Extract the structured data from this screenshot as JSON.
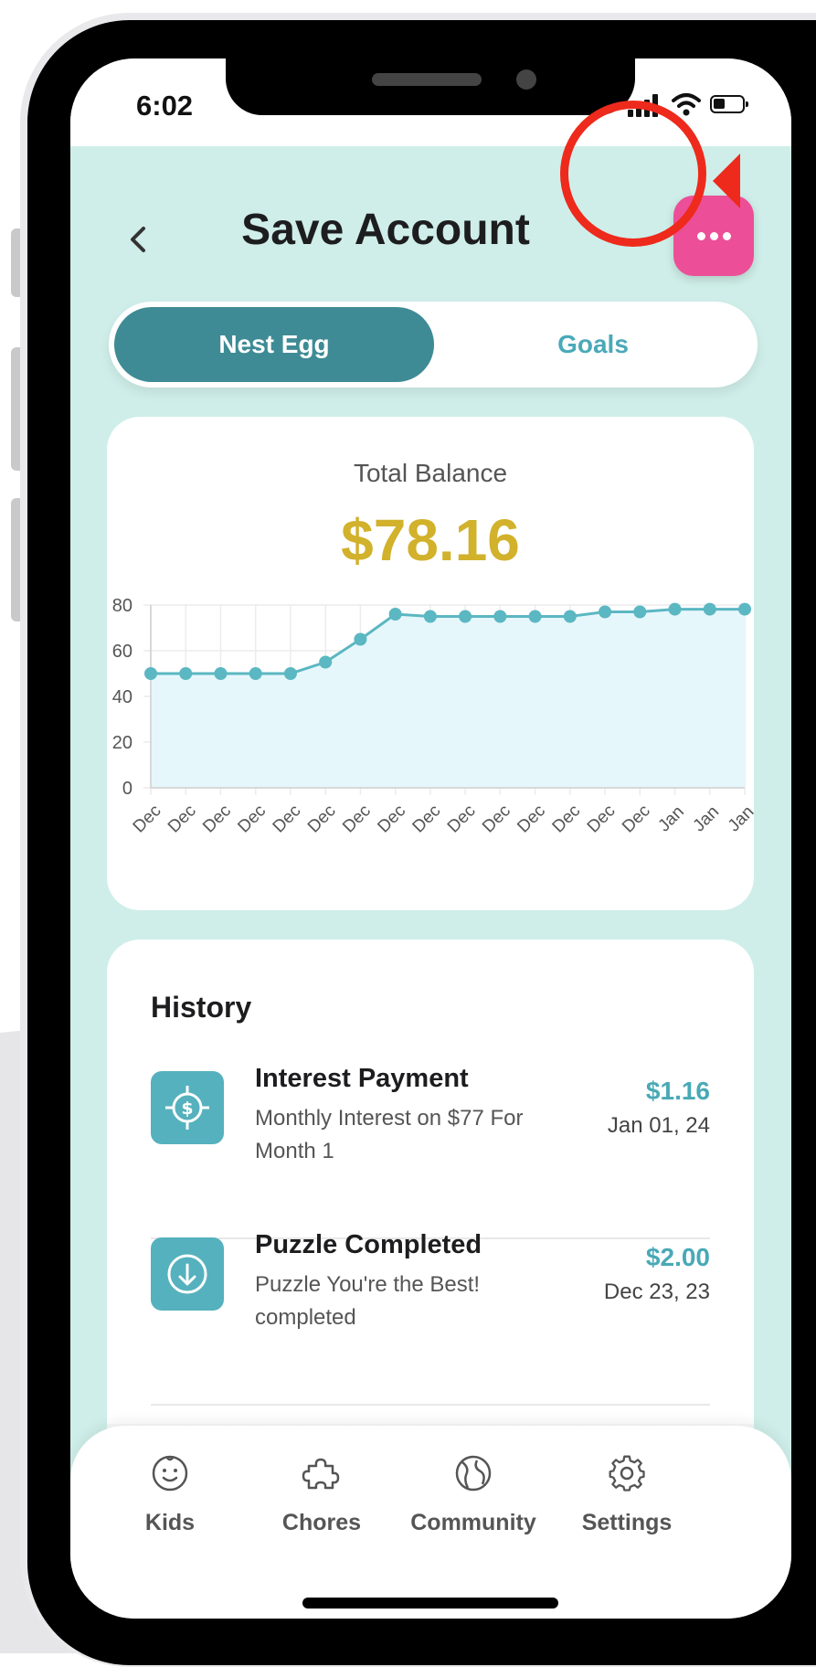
{
  "status_bar": {
    "time": "6:02"
  },
  "header": {
    "title": "Save Account"
  },
  "segmented": {
    "active": "Nest Egg",
    "inactive": "Goals"
  },
  "balance": {
    "label": "Total Balance",
    "amount": "$78.16"
  },
  "chart_data": {
    "type": "area",
    "categories": [
      "Dec",
      "Dec",
      "Dec",
      "Dec",
      "Dec",
      "Dec",
      "Dec",
      "Dec",
      "Dec",
      "Dec",
      "Dec",
      "Dec",
      "Dec",
      "Dec",
      "Dec",
      "Jan",
      "Jan",
      "Jan"
    ],
    "values": [
      50,
      50,
      50,
      50,
      50,
      55,
      65,
      76,
      75,
      75,
      75,
      75,
      75,
      77,
      77,
      78.16,
      78.16,
      78.16
    ],
    "ylim": [
      0,
      80
    ],
    "yticks": [
      "0",
      "20",
      "40",
      "60",
      "80"
    ],
    "grid": true,
    "line_color": "#5bb7c2",
    "fill_color": "#e6f7fc"
  },
  "history": {
    "title": "History",
    "items": [
      {
        "name": "Interest Payment",
        "desc": "Monthly Interest on $77 For\nMonth 1",
        "amount": "$1.16",
        "date": "Jan 01, 24",
        "icon": "target-dollar-icon"
      },
      {
        "name": "Puzzle Completed",
        "desc": "Puzzle You're the Best!\n completed",
        "amount": "$2.00",
        "date": "Dec 23, 23",
        "icon": "download-circle-icon"
      }
    ]
  },
  "tabs": [
    {
      "label": "Kids",
      "icon": "smiley-icon"
    },
    {
      "label": "Chores",
      "icon": "puzzle-icon"
    },
    {
      "label": "Community",
      "icon": "globe-icon"
    },
    {
      "label": "Settings",
      "icon": "gear-icon"
    }
  ],
  "colors": {
    "accent": "#3e8b95",
    "pink": "#ec4f97",
    "gold": "#d2b12b",
    "highlight": "#ee2a1c"
  }
}
